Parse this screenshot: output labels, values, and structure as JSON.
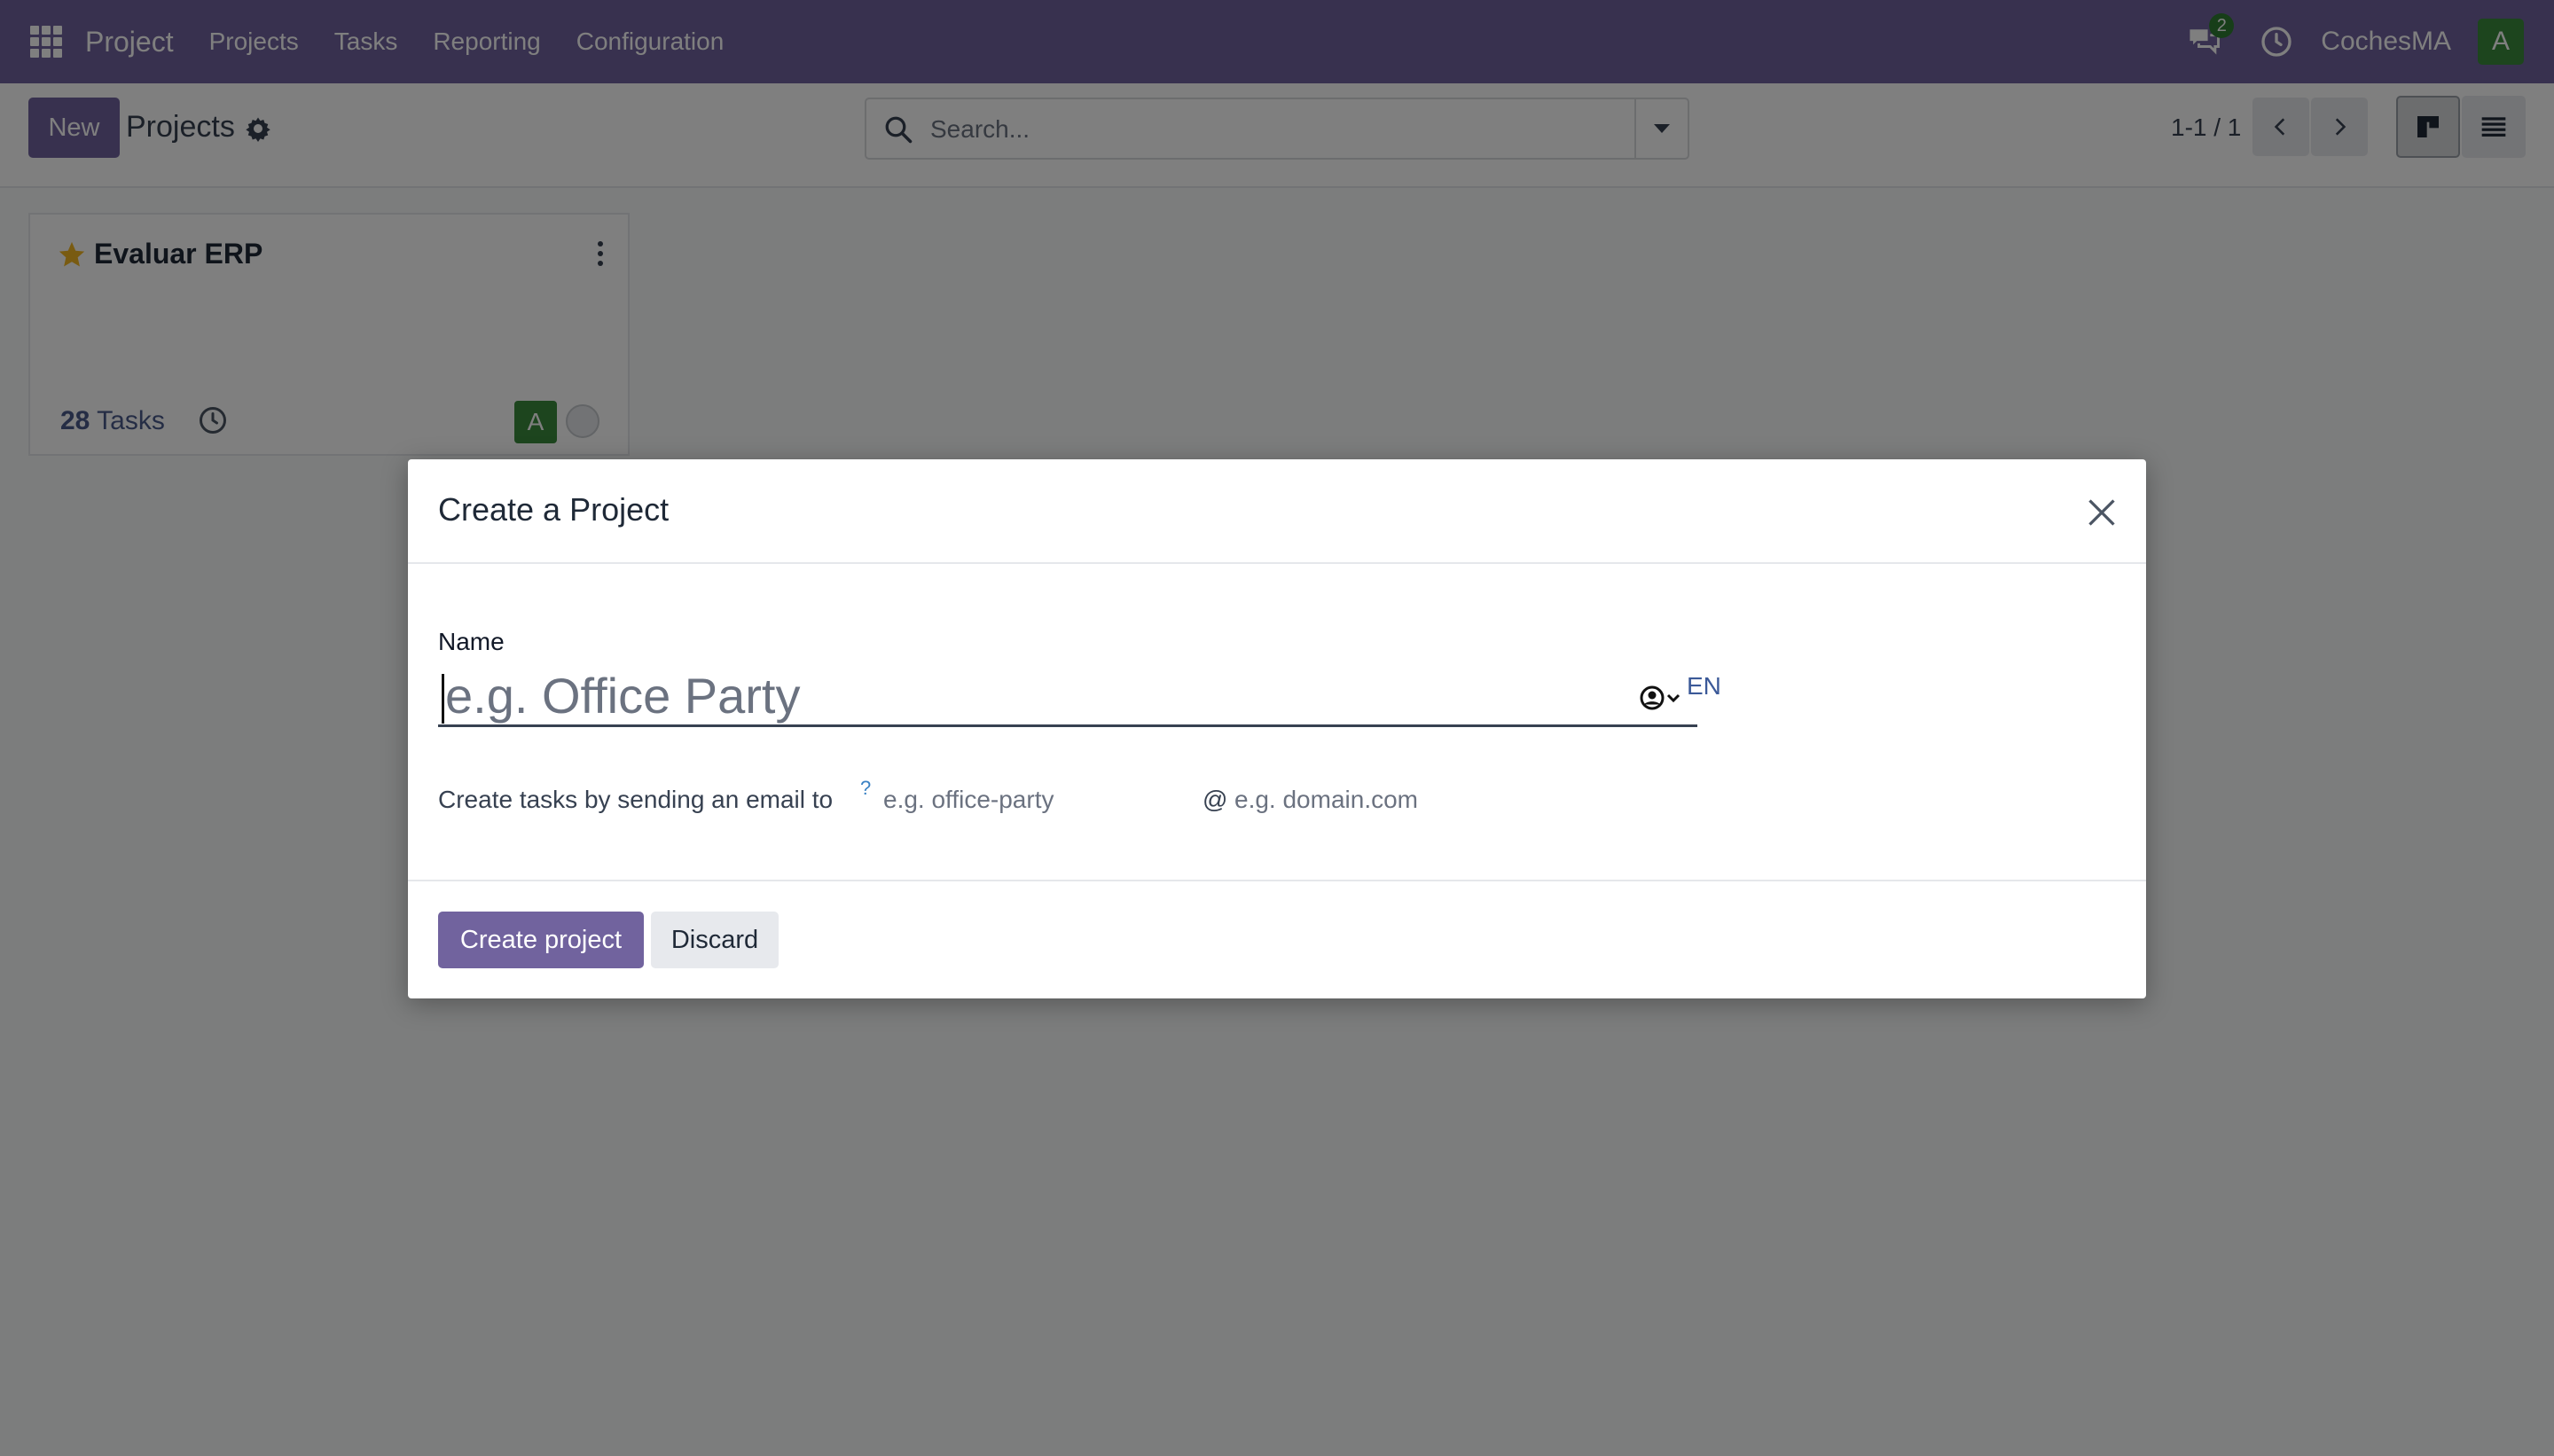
{
  "navbar": {
    "app_name": "Project",
    "menu": [
      "Projects",
      "Tasks",
      "Reporting",
      "Configuration"
    ],
    "chat_badge": "2",
    "company": "CochesMA",
    "user_initial": "A",
    "color": "#71639e"
  },
  "control_panel": {
    "new_label": "New",
    "title": "Projects",
    "search_placeholder": "Search...",
    "pager": "1-1 / 1"
  },
  "project_card": {
    "name": "Evaluar ERP",
    "task_count": "28",
    "task_label": "Tasks",
    "user_initial": "A",
    "favorite": true
  },
  "dialog": {
    "title": "Create a Project",
    "name_label": "Name",
    "name_placeholder": "e.g. Office Party",
    "lang": "EN",
    "email_label": "Create tasks by sending an email to",
    "help_mark": "?",
    "alias_placeholder": "e.g. office-party",
    "at": "@",
    "domain_placeholder": "e.g. domain.com",
    "create_label": "Create project",
    "discard_label": "Discard"
  }
}
